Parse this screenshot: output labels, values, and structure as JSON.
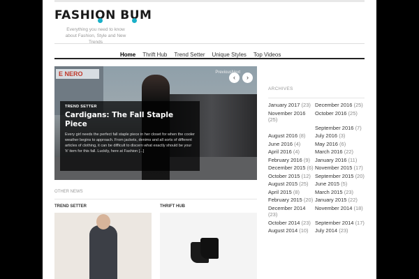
{
  "site": {
    "logo": "FASHION BUM",
    "tagline": "Everything you need to know about Fashion, Style and New Trends"
  },
  "nav": {
    "items": [
      "Home",
      "Thrift Hub",
      "Trend Setter",
      "Unique Styles",
      "Top Videos"
    ],
    "active_index": 0
  },
  "slider": {
    "prev_next_text": "PreviousNext",
    "category": "TREND SETTER",
    "title": "Cardigans: The Fall Staple Piece",
    "excerpt": "Every girl needs the perfect fall staple piece in her closet for when the cooler weather begins to approach. From jackets, denims and all sorts of different articles of clothing, it can be difficult to discern what exactly should be your 'it' item for this fall. Luckily, here at Fashion [...]"
  },
  "other_news": {
    "heading": "OTHER NEWS",
    "cards": [
      {
        "category": "TREND SETTER"
      },
      {
        "category": "THRIFT HUB"
      }
    ]
  },
  "archives": {
    "heading": "ARCHIVES",
    "items": [
      {
        "label": "January 2017",
        "count": "(23)"
      },
      {
        "label": "December 2016",
        "count": "(25)"
      },
      {
        "label": "November 2016",
        "count": "(25)"
      },
      {
        "label": "October 2016",
        "count": "(25)"
      },
      {
        "label": "",
        "count": ""
      },
      {
        "label": "September 2016",
        "count": "(7)"
      },
      {
        "label": "August 2016",
        "count": "(8)"
      },
      {
        "label": "July 2016",
        "count": "(3)"
      },
      {
        "label": "June 2016",
        "count": "(4)"
      },
      {
        "label": "May 2016",
        "count": "(6)"
      },
      {
        "label": "April 2016",
        "count": "(4)"
      },
      {
        "label": "March 2016",
        "count": "(22)"
      },
      {
        "label": "February 2016",
        "count": "(9)"
      },
      {
        "label": "January 2016",
        "count": "(11)"
      },
      {
        "label": "December 2015",
        "count": "(6)"
      },
      {
        "label": "November 2015",
        "count": "(17)"
      },
      {
        "label": "October 2015",
        "count": "(12)"
      },
      {
        "label": "September 2015",
        "count": "(20)"
      },
      {
        "label": "August 2015",
        "count": "(25)"
      },
      {
        "label": "June 2015",
        "count": "(5)"
      },
      {
        "label": "April 2015",
        "count": "(8)"
      },
      {
        "label": "March 2015",
        "count": "(23)"
      },
      {
        "label": "February 2015",
        "count": "(20)"
      },
      {
        "label": "January 2015",
        "count": "(22)"
      },
      {
        "label": "December 2014",
        "count": "(23)"
      },
      {
        "label": "November 2014",
        "count": "(18)"
      },
      {
        "label": "October 2014",
        "count": "(23)"
      },
      {
        "label": "September 2014",
        "count": "(17)"
      },
      {
        "label": "August 2014",
        "count": "(10)"
      },
      {
        "label": "July 2014",
        "count": "(23)"
      }
    ]
  },
  "colors": {
    "logo_accent": "#1ab0c8",
    "nav_rule": "#222222",
    "outer_bg": "#000000"
  }
}
